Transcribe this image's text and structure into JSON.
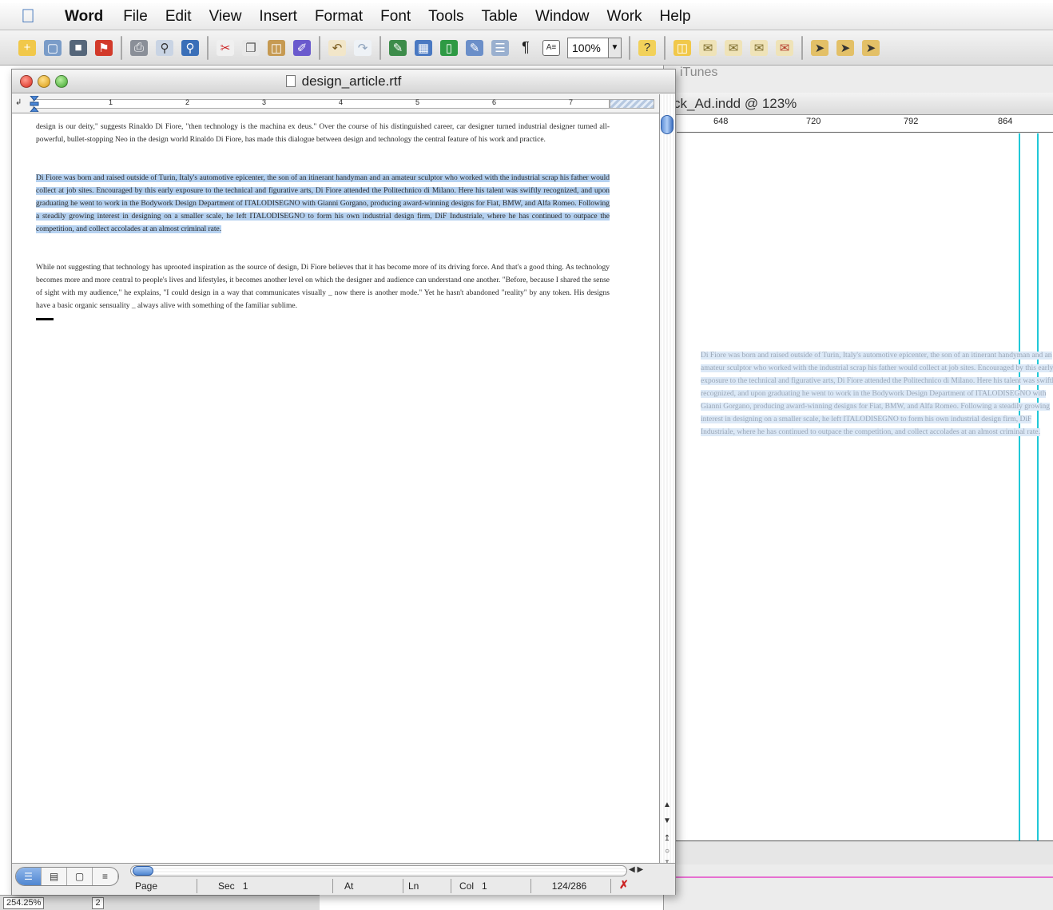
{
  "menubar": {
    "app_name": "Word",
    "items": [
      "File",
      "Edit",
      "View",
      "Insert",
      "Format",
      "Font",
      "Tools",
      "Table",
      "Window",
      "Work",
      "Help"
    ]
  },
  "toolbar": {
    "zoom": "100%"
  },
  "background_window": {
    "app_label": "iTunes",
    "title": "ck_Ad.indd @ 123%",
    "ruler_labels": [
      "648",
      "720",
      "792",
      "864"
    ],
    "ghost_text": "Di Fiore was born and raised outside of Turin, Italy's automotive epicenter, the son of an itinerant handyman and an amateur sculptor who worked with the industrial scrap his father would collect at job sites. Encouraged by this early exposure to the technical and figurative arts, Di Fiore attended the Politechnico di Milano. Here his talent was swiftly recognized, and upon graduating he went to work in the Bodywork Design Department of ITALODISEGNO with Gianni Gorgano, producing award-winning designs for Fiat, BMW, and Alfa Romeo. Following a steadily growing interest in designing on a smaller scale, he left ITALODISEGNO to form his own industrial design firm, DiF Industriale, where he has continued to outpace the competition, and collect accolades at an almost criminal rate."
  },
  "footer_strip": {
    "zoom": "254.25%",
    "page": "2"
  },
  "document_window": {
    "title": "design_article.rtf",
    "ruler_numbers": [
      "1",
      "2",
      "3",
      "4",
      "5",
      "6",
      "7"
    ],
    "paragraphs": [
      "design is our deity,\" suggests Rinaldo Di Fiore, \"then technology is the machina ex deus.\" Over the course of his distinguished career, car designer turned industrial designer turned all-powerful, bullet-stopping Neo in the design world Rinaldo Di Fiore, has made this dialogue between design and technology the central feature of his work and practice.",
      "Di Fiore was born and raised outside of Turin, Italy's automotive epicenter, the son of an itinerant handyman and an amateur sculptor who worked with the industrial scrap his father would collect at job sites. Encouraged by this early exposure to the technical and figurative arts, Di Fiore attended the Politechnico di Milano. Here his talent was swiftly recognized, and upon graduating he went to work in the Bodywork Design Department of ITALODISEGNO with Gianni Gorgano, producing award-winning designs for Fiat, BMW, and Alfa Romeo. Following a steadily growing interest in designing on a smaller scale, he left ITALODISEGNO to form his own industrial design firm, DiF Industriale, where he has continued to outpace the competition, and collect accolades at an almost criminal rate.",
      "While not suggesting that technology has uprooted inspiration as the source of design, Di Fiore believes that it has become more of its driving force. And that's a good thing. As technology becomes more and more central to people's lives and lifestyles, it becomes another level on which the designer and audience can understand one another. \"Before, because I shared the sense of sight with my audience,\" he explains, \"I could design in a way that communicates visually _ now there is another mode.\" Yet he hasn't abandoned \"reality\" by any token. His designs have a basic organic sensuality _ always alive with something of the familiar sublime."
    ],
    "status": {
      "page_label": "Page",
      "sec_label": "Sec",
      "sec_value": "1",
      "at_label": "At",
      "ln_label": "Ln",
      "col_label": "Col",
      "col_value": "1",
      "word_count": "124/286"
    }
  }
}
